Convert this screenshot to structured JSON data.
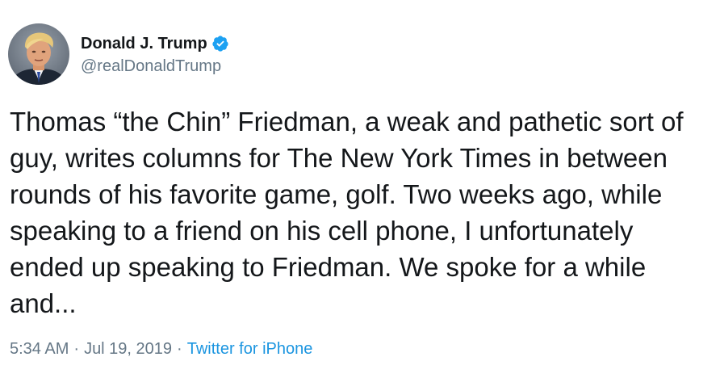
{
  "author": {
    "display_name": "Donald J. Trump",
    "handle": "@realDonaldTrump",
    "verified": true,
    "verified_icon": "verified-badge-icon"
  },
  "tweet": {
    "text": "Thomas “the Chin” Friedman, a weak and pathetic sort of\nguy, writes columns for The New York Times in between\nrounds of his favorite game, golf. Two weeks ago, while\nspeaking to a friend on his cell phone, I unfortunately\nended up speaking to Friedman. We spoke for a while\nand..."
  },
  "meta": {
    "time": "5:34 AM",
    "separator": "·",
    "date": "Jul 19, 2019",
    "source": "Twitter for iPhone"
  },
  "colors": {
    "text_primary": "#14171a",
    "text_secondary": "#657786",
    "link": "#1b95e0",
    "verified": "#1da1f2"
  }
}
